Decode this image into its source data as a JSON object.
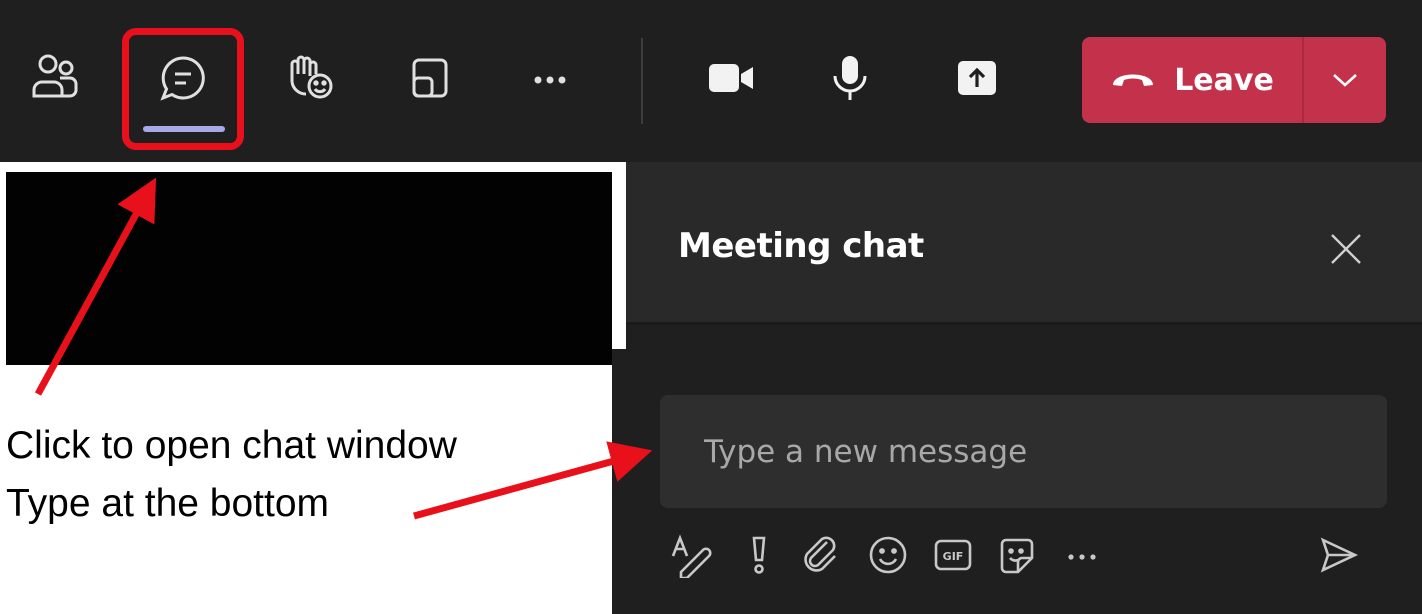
{
  "toolbar": {
    "icons": [
      "people-icon",
      "chat-icon",
      "raise-hand-react-icon",
      "view-layout-icon",
      "more-options-icon",
      "camera-icon",
      "microphone-icon",
      "share-screen-icon"
    ],
    "leave_label": "Leave",
    "leave_color": "#c4314b",
    "active_indicator_color": "#a6a8e8"
  },
  "chat": {
    "title": "Meeting chat",
    "input_placeholder": "Type a new message",
    "compose_icons": [
      "format-icon",
      "important-icon",
      "attach-icon",
      "emoji-icon",
      "gif-icon",
      "sticker-icon",
      "more-options-icon",
      "send-icon"
    ]
  },
  "annotations": {
    "line1": "Click to open chat window",
    "line2": "Type at the bottom",
    "highlight_color": "#e8101a"
  }
}
